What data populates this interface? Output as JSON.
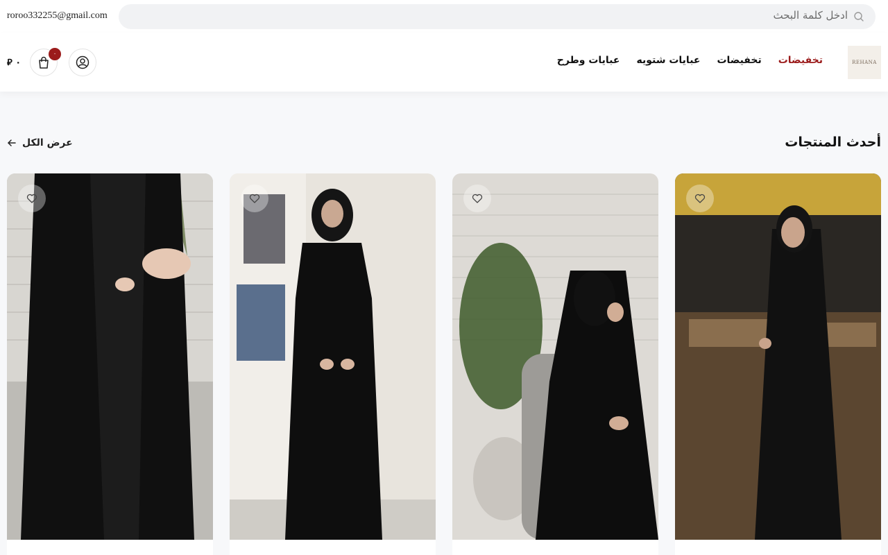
{
  "topbar": {
    "email": "roroo332255@gmail.com",
    "search_placeholder": "ادخل كلمة البحث"
  },
  "header": {
    "logo_text": "REHANA",
    "nav": [
      {
        "label": "عبايات وطرح"
      },
      {
        "label": "عبايات شتويه"
      },
      {
        "label": "تخفيضات"
      },
      {
        "label": "تخفيضات",
        "active": true
      }
    ],
    "cart_count": "٠",
    "cart_total": "٠ ⃁"
  },
  "section": {
    "title": "أحدث المنتجات",
    "view_all": "عرض الكل"
  },
  "products": [
    {
      "image": "black-velvet-abaya-restaurant-photo"
    },
    {
      "image": "black-abaya-lace-sleeves-photo"
    },
    {
      "image": "black-abaya-hijab-photo"
    },
    {
      "image": "black-velvet-abaya-lace-photo"
    }
  ],
  "colors": {
    "accent": "#9b1b1b",
    "text": "#111111",
    "background": "#f7f8fa"
  }
}
